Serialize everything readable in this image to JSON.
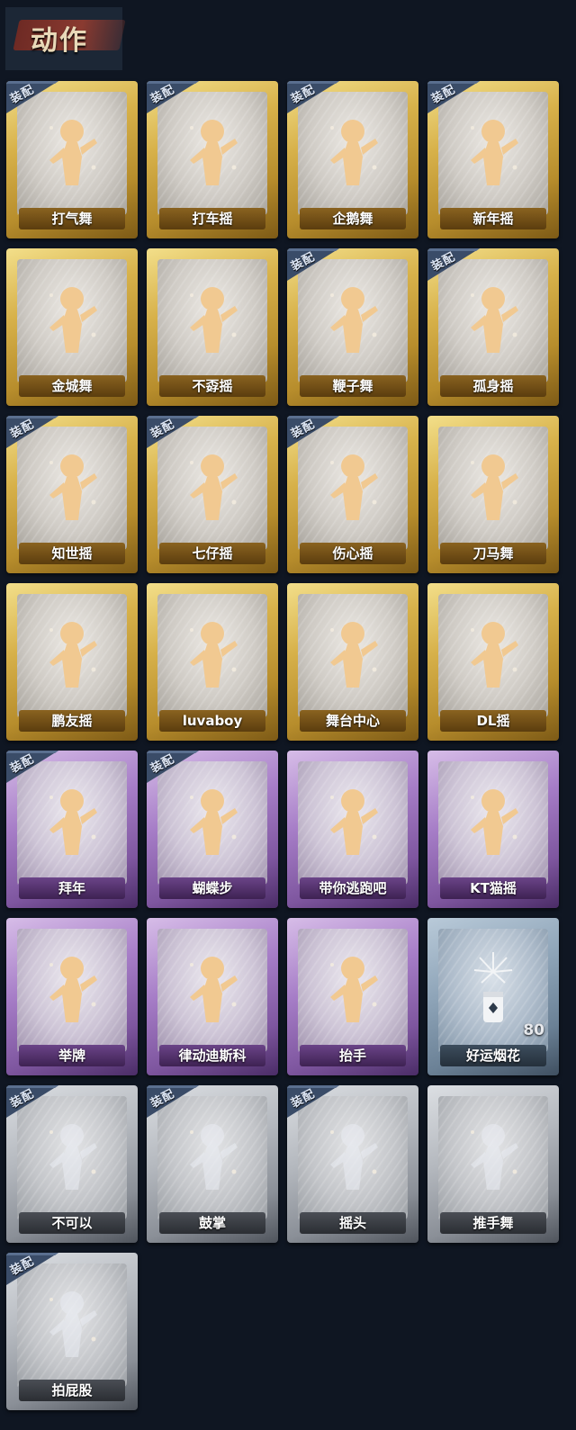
{
  "header": {
    "title": "动作"
  },
  "badge_label": "装配",
  "items": [
    {
      "name": "打气舞",
      "tier": "gold",
      "equipped": true,
      "icon": "dance-figure-icon"
    },
    {
      "name": "打车摇",
      "tier": "gold",
      "equipped": true,
      "icon": "dance-figure-icon"
    },
    {
      "name": "企鹅舞",
      "tier": "gold",
      "equipped": true,
      "icon": "dance-figure-icon"
    },
    {
      "name": "新年摇",
      "tier": "gold",
      "equipped": true,
      "icon": "dance-figure-icon"
    },
    {
      "name": "金城舞",
      "tier": "gold",
      "equipped": false,
      "icon": "dance-figure-icon"
    },
    {
      "name": "不孬摇",
      "tier": "gold",
      "equipped": false,
      "icon": "dance-figure-icon"
    },
    {
      "name": "鞭子舞",
      "tier": "gold",
      "equipped": true,
      "icon": "dance-figure-icon"
    },
    {
      "name": "孤身摇",
      "tier": "gold",
      "equipped": true,
      "icon": "dance-figure-icon"
    },
    {
      "name": "知世摇",
      "tier": "gold",
      "equipped": true,
      "icon": "dance-figure-icon"
    },
    {
      "name": "七仔摇",
      "tier": "gold",
      "equipped": true,
      "icon": "dance-figure-icon"
    },
    {
      "name": "伤心摇",
      "tier": "gold",
      "equipped": true,
      "icon": "heart-hands-figure-icon"
    },
    {
      "name": "刀马舞",
      "tier": "gold",
      "equipped": false,
      "icon": "dance-figure-icon"
    },
    {
      "name": "鹏友摇",
      "tier": "gold",
      "equipped": false,
      "icon": "dance-figure-icon"
    },
    {
      "name": "luvaboy",
      "tier": "gold",
      "equipped": false,
      "icon": "dance-figure-icon"
    },
    {
      "name": "舞台中心",
      "tier": "gold",
      "equipped": false,
      "icon": "dance-figure-icon"
    },
    {
      "name": "DL摇",
      "tier": "gold",
      "equipped": false,
      "icon": "dance-figure-icon"
    },
    {
      "name": "拜年",
      "tier": "purple",
      "equipped": true,
      "icon": "bow-figure-icon"
    },
    {
      "name": "蝴蝶步",
      "tier": "purple",
      "equipped": true,
      "icon": "dance-figure-icon"
    },
    {
      "name": "带你逃跑吧",
      "tier": "purple",
      "equipped": false,
      "icon": "dance-figure-icon"
    },
    {
      "name": "KT猫摇",
      "tier": "purple",
      "equipped": false,
      "icon": "dance-figure-icon"
    },
    {
      "name": "举牌",
      "tier": "purple",
      "equipped": false,
      "icon": "sign-holder-icon"
    },
    {
      "name": "律动迪斯科",
      "tier": "purple",
      "equipped": false,
      "icon": "disco-figure-icon"
    },
    {
      "name": "抬手",
      "tier": "purple",
      "equipped": false,
      "icon": "raise-hand-icon"
    },
    {
      "name": "好运烟花",
      "tier": "blue",
      "equipped": false,
      "icon": "firework-icon",
      "count": "80"
    },
    {
      "name": "不可以",
      "tier": "gray",
      "equipped": true,
      "icon": "finger-wag-icon"
    },
    {
      "name": "鼓掌",
      "tier": "gray",
      "equipped": true,
      "icon": "clap-icon"
    },
    {
      "name": "摇头",
      "tier": "gray",
      "equipped": true,
      "icon": "shake-head-icon"
    },
    {
      "name": "推手舞",
      "tier": "gray",
      "equipped": false,
      "icon": "push-hands-icon"
    },
    {
      "name": "拍屁股",
      "tier": "gray",
      "equipped": true,
      "icon": "slap-figure-icon"
    }
  ]
}
